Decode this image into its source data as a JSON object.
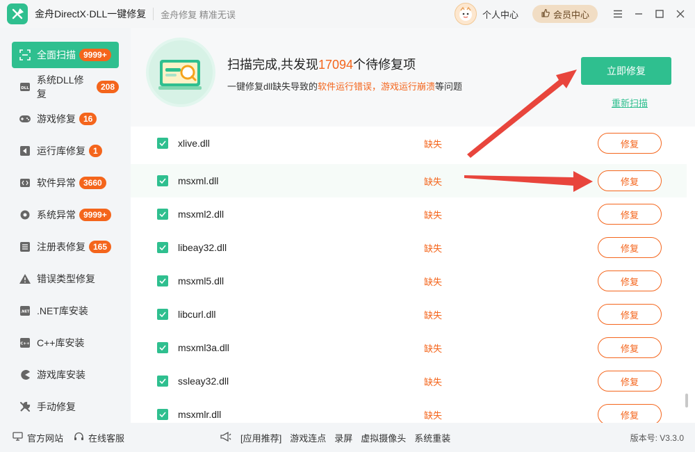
{
  "titlebar": {
    "app_title": "金舟DirectX·DLL一键修复",
    "slogan": "金舟修复 精准无误",
    "personal_center": "个人中心",
    "vip_center": "会员中心"
  },
  "sidebar": {
    "items": [
      {
        "label": "全面扫描",
        "badge": "9999+",
        "icon": "scan-icon",
        "active": true
      },
      {
        "label": "系统DLL修复",
        "badge": "208",
        "icon": "dll-icon"
      },
      {
        "label": "游戏修复",
        "badge": "16",
        "icon": "gamepad-icon"
      },
      {
        "label": "运行库修复",
        "badge": "1",
        "icon": "runtime-icon"
      },
      {
        "label": "软件异常",
        "badge": "3660",
        "icon": "software-icon"
      },
      {
        "label": "系统异常",
        "badge": "9999+",
        "icon": "gear-icon"
      },
      {
        "label": "注册表修复",
        "badge": "165",
        "icon": "list-icon"
      },
      {
        "label": "错误类型修复",
        "icon": "warning-icon"
      },
      {
        "label": ".NET库安装",
        "icon": "dotnet-icon"
      },
      {
        "label": "C++库安装",
        "icon": "cpp-icon"
      },
      {
        "label": "游戏库安装",
        "icon": "game-lib-icon"
      },
      {
        "label": "手动修复",
        "icon": "wrench-icon"
      }
    ]
  },
  "header": {
    "title_prefix": "扫描完成,共发现",
    "count": "17094",
    "title_suffix": "个待修复项",
    "desc_prefix": "一键修复dll缺失导致的",
    "desc_warn": "软件运行错误，游戏运行崩溃",
    "desc_suffix": "等问题",
    "fix_now": "立即修复",
    "rescan": "重新扫描"
  },
  "files": [
    {
      "name": "xlive.dll",
      "status": "缺失",
      "action": "修复"
    },
    {
      "name": "msxml.dll",
      "status": "缺失",
      "action": "修复"
    },
    {
      "name": "msxml2.dll",
      "status": "缺失",
      "action": "修复"
    },
    {
      "name": "libeay32.dll",
      "status": "缺失",
      "action": "修复"
    },
    {
      "name": "msxml5.dll",
      "status": "缺失",
      "action": "修复"
    },
    {
      "name": "libcurl.dll",
      "status": "缺失",
      "action": "修复"
    },
    {
      "name": "msxml3a.dll",
      "status": "缺失",
      "action": "修复"
    },
    {
      "name": "ssleay32.dll",
      "status": "缺失",
      "action": "修复"
    },
    {
      "name": "msxmlr.dll",
      "status": "缺失",
      "action": "修复"
    }
  ],
  "footer": {
    "official_site": "官方网站",
    "online_service": "在线客服",
    "tools": [
      "[应用推荐]",
      "游戏连点",
      "录屏",
      "虚拟摄像头",
      "系统重装"
    ],
    "version": "版本号: V3.3.0"
  },
  "colors": {
    "accent": "#2fbf8f",
    "warning": "#f4651c",
    "arrow": "#e8453c"
  }
}
